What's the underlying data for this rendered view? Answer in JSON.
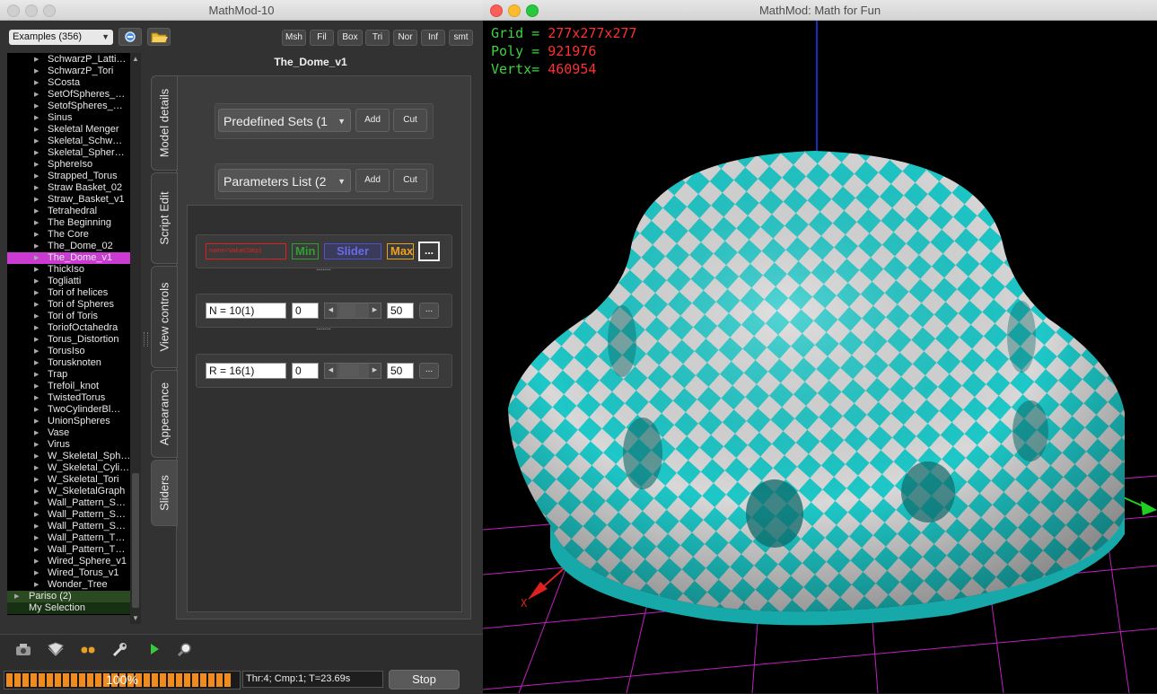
{
  "left_window": {
    "title": "MathMod-10",
    "examples_combo": "Examples (356)",
    "toolbar_buttons": [
      "Msh",
      "Fil",
      "Box",
      "Tri",
      "Nor",
      "Inf",
      "smt"
    ],
    "tree_items": [
      "SchwarzP_Latti…",
      "SchwarzP_Tori",
      "SCosta",
      "SetOfSpheres_…",
      "SetofSpheres_…",
      "Sinus",
      "Skeletal Menger",
      "Skeletal_Schw…",
      "Skeletal_Spher…",
      "SphereIso",
      "Strapped_Torus",
      "Straw Basket_02",
      "Straw_Basket_v1",
      "Tetrahedral",
      "The Beginning",
      "The Core",
      "The_Dome_02",
      "The_Dome_v1",
      "ThickIso",
      "Togliatti",
      "Tori of helices",
      "Tori of Spheres",
      "Tori of Toris",
      "ToriofOctahedra",
      "Torus_Distortion",
      "TorusIso",
      "Torusknoten",
      "Trap",
      "Trefoil_knot",
      "TwistedTorus",
      "TwoCylinderBl…",
      "UnionSpheres",
      "Vase",
      "Virus",
      "W_Skeletal_Sph…",
      "W_Skeletal_Cyli…",
      "W_Skeletal_Tori",
      "W_SkeletalGraph",
      "Wall_Pattern_S…",
      "Wall_Pattern_S…",
      "Wall_Pattern_S…",
      "Wall_Pattern_T…",
      "Wall_Pattern_T…",
      "Wired_Sphere_v1",
      "Wired_Torus_v1",
      "Wonder_Tree"
    ],
    "selected_item": "The_Dome_v1",
    "group_pariso": "Pariso (2)",
    "group_selection": "My Selection",
    "model_title": "The_Dome_v1",
    "side_tabs": [
      "Model details",
      "Script Edit",
      "View controls",
      "Appearance",
      "Sliders"
    ],
    "predefined_sets": "Predefined Sets (1",
    "parameters_list": "Parameters List (2",
    "add_label": "Add",
    "cut_label": "Cut",
    "header_row": {
      "name_placeholder": "name=Value(Step)",
      "min": "Min",
      "slider": "Slider",
      "max": "Max",
      "more": "..."
    },
    "sliders": [
      {
        "name": "N = 10(1)",
        "min": "0",
        "max": "50",
        "more": "...",
        "value": 0.2
      },
      {
        "name": "R = 16(1)",
        "min": "0",
        "max": "50",
        "more": "...",
        "value": 0.32
      }
    ],
    "progress_text": "100%",
    "progress_value": 1.0,
    "status_text": "Thr:4; Cmp:1; T=23.69s",
    "stop_label": "Stop"
  },
  "right_window": {
    "title": "MathMod: Math for Fun",
    "hud": [
      {
        "key": "Grid = ",
        "value": "277x277x277"
      },
      {
        "key": "Poly = ",
        "value": "921976"
      },
      {
        "key": "Vertx= ",
        "value": "460954"
      }
    ],
    "axis_label": "X"
  },
  "colors": {
    "selection": "#c93bd1",
    "progress": "#f08c1e",
    "surface_a": "#1ec8c8",
    "surface_b": "#d8d8d8",
    "grid": "#c020c0"
  }
}
